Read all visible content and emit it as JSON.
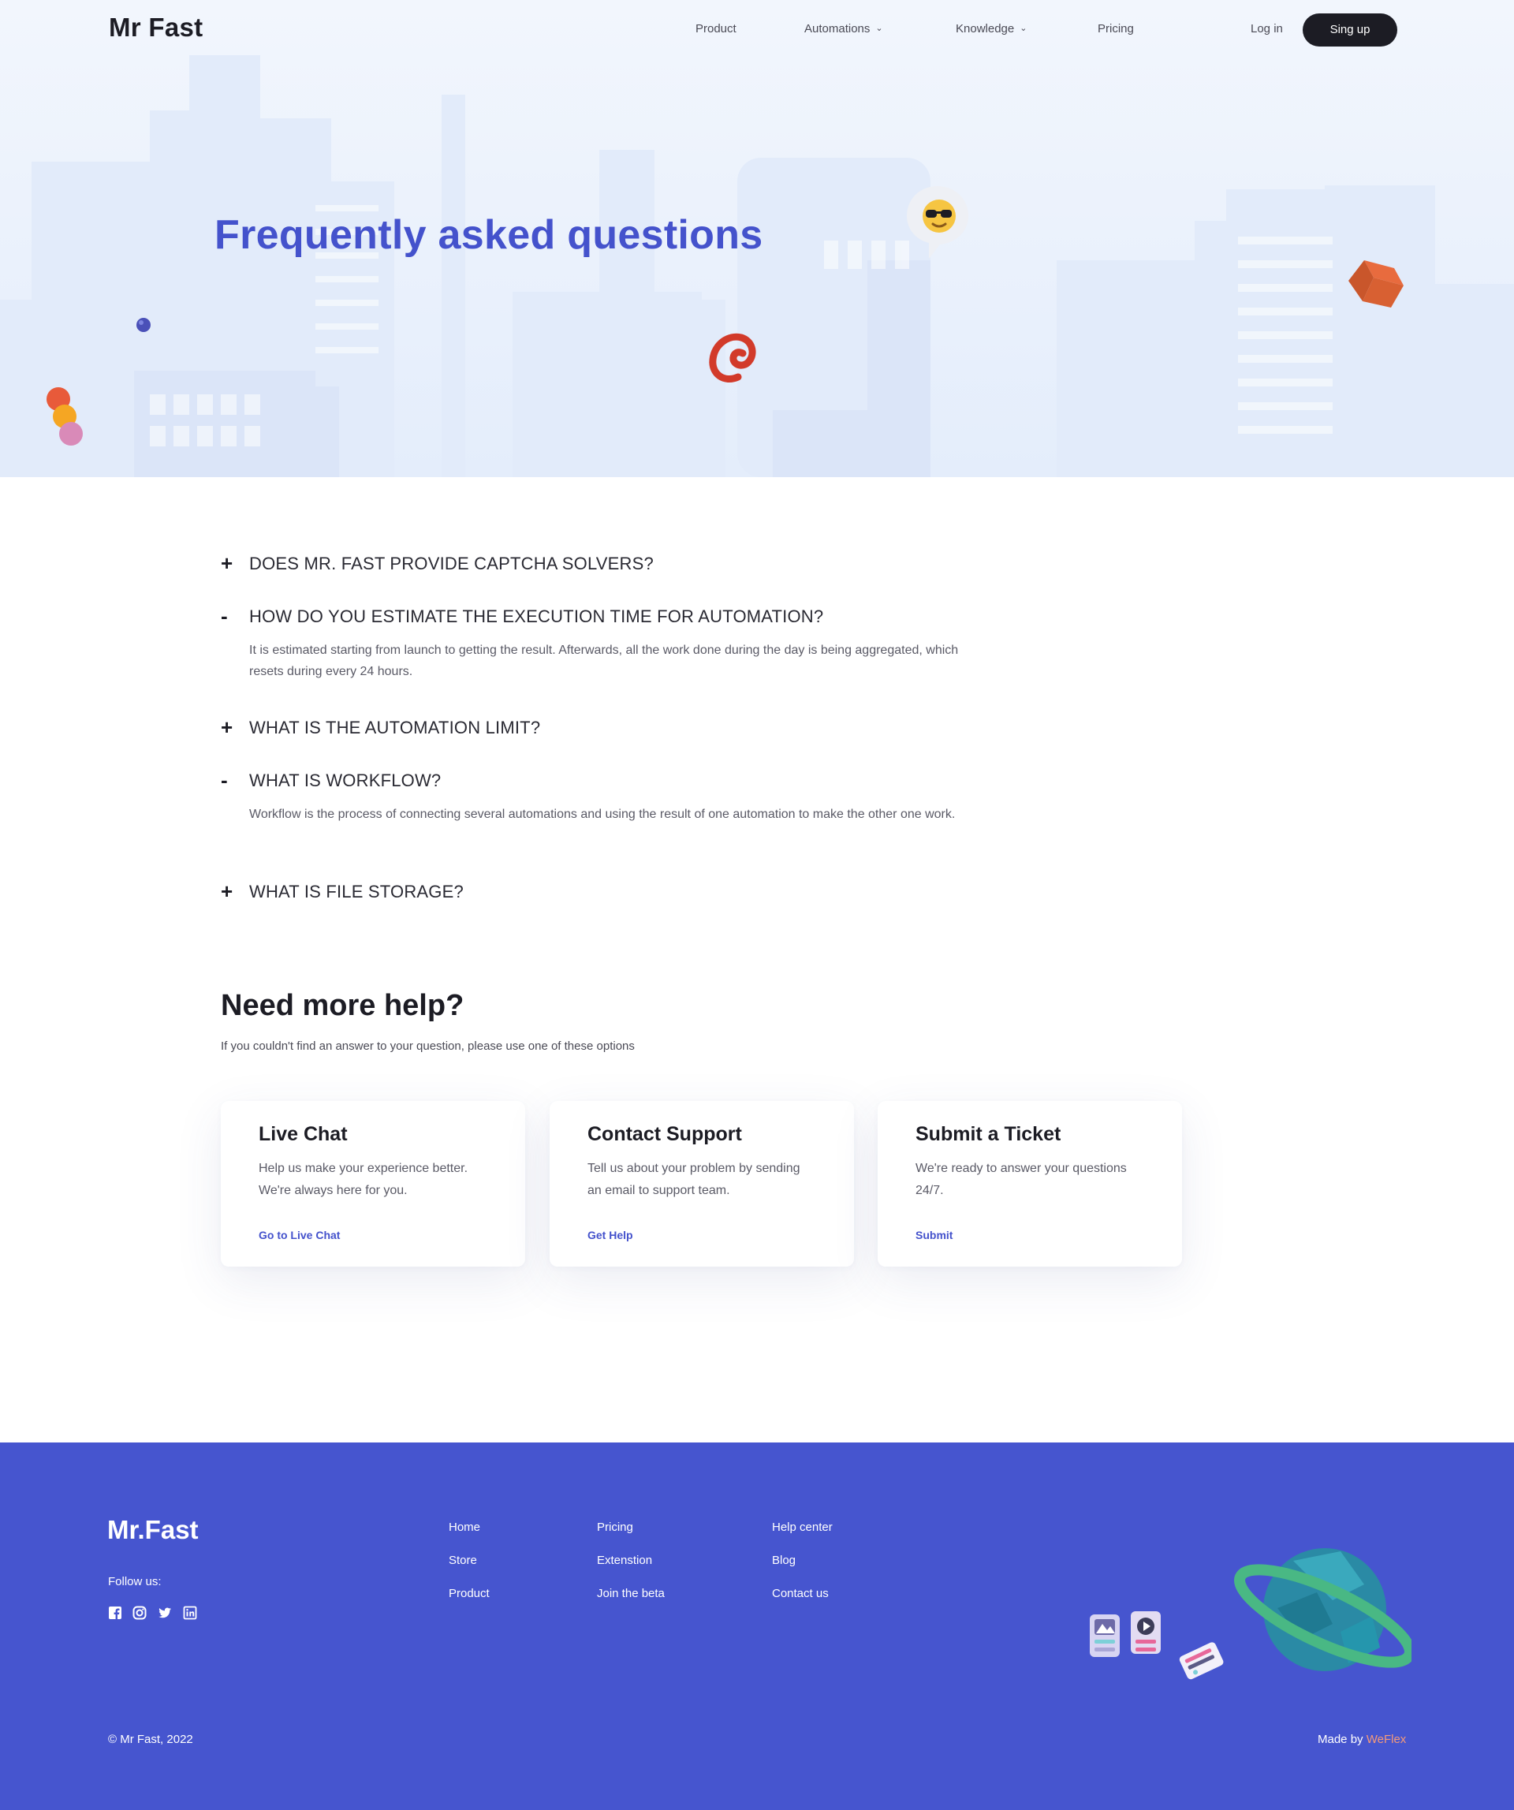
{
  "nav": {
    "logo": "Mr Fast",
    "links": [
      {
        "label": "Product",
        "has_dropdown": false
      },
      {
        "label": "Automations",
        "has_dropdown": true
      },
      {
        "label": "Knowledge",
        "has_dropdown": true
      },
      {
        "label": "Pricing",
        "has_dropdown": false
      }
    ],
    "login": "Log in",
    "signup": "Sing up"
  },
  "hero": {
    "title": "Frequently asked questions",
    "icons": [
      "sunglasses-emoji-icon",
      "at-sign-icon",
      "cube-icon",
      "sphere-stack-icon"
    ]
  },
  "faq": [
    {
      "question": "DOES MR. FAST PROVIDE CAPTCHA SOLVERS?",
      "expanded": false,
      "sign": "+",
      "answer": ""
    },
    {
      "question": "HOW DO YOU ESTIMATE THE EXECUTION TIME FOR AUTOMATION?",
      "expanded": true,
      "sign": "-",
      "answer": "It is estimated starting from launch to getting the result. Afterwards, all the work done during the day is being aggregated, which resets during every 24 hours."
    },
    {
      "question": "WHAT IS THE AUTOMATION LIMIT?",
      "expanded": false,
      "sign": "+",
      "answer": ""
    },
    {
      "question": "WHAT IS WORKFLOW?",
      "expanded": true,
      "sign": "-",
      "answer": "Workflow is the process of connecting several automations and using the result of one automation to make the other one work."
    },
    {
      "question": "WHAT IS FILE STORAGE?",
      "expanded": false,
      "sign": "+",
      "answer": ""
    }
  ],
  "help": {
    "title": "Need more help?",
    "subtitle": "If you couldn't find an answer to your question, please use one of these options",
    "cards": [
      {
        "title": "Live Chat",
        "text": "Help us make your experience better. We're always here for you.",
        "link": "Go to Live Chat"
      },
      {
        "title": "Contact Support",
        "text": "Tell us about your problem by sending an email to support team.",
        "link": "Get Help"
      },
      {
        "title": "Submit a Ticket",
        "text": "We're ready to answer your questions 24/7.",
        "link": "Submit"
      }
    ]
  },
  "footer": {
    "logo": "Mr.Fast",
    "follow": "Follow us:",
    "social_icons": [
      "facebook-icon",
      "instagram-icon",
      "twitter-icon",
      "linkedin-icon"
    ],
    "columns": [
      [
        "Home",
        "Store",
        "Product"
      ],
      [
        "Pricing",
        "Extenstion",
        "Join the beta"
      ],
      [
        "Help center",
        "Blog",
        "Contact us"
      ]
    ],
    "copyright": "© Mr Fast, 2022",
    "made_by_prefix": "Made by",
    "made_by_brand": "WeFlex"
  },
  "colors": {
    "accent": "#4452cc",
    "footer_bg": "#4655cf",
    "dark": "#1c1c24",
    "brand_highlight": "#f59a7a"
  }
}
